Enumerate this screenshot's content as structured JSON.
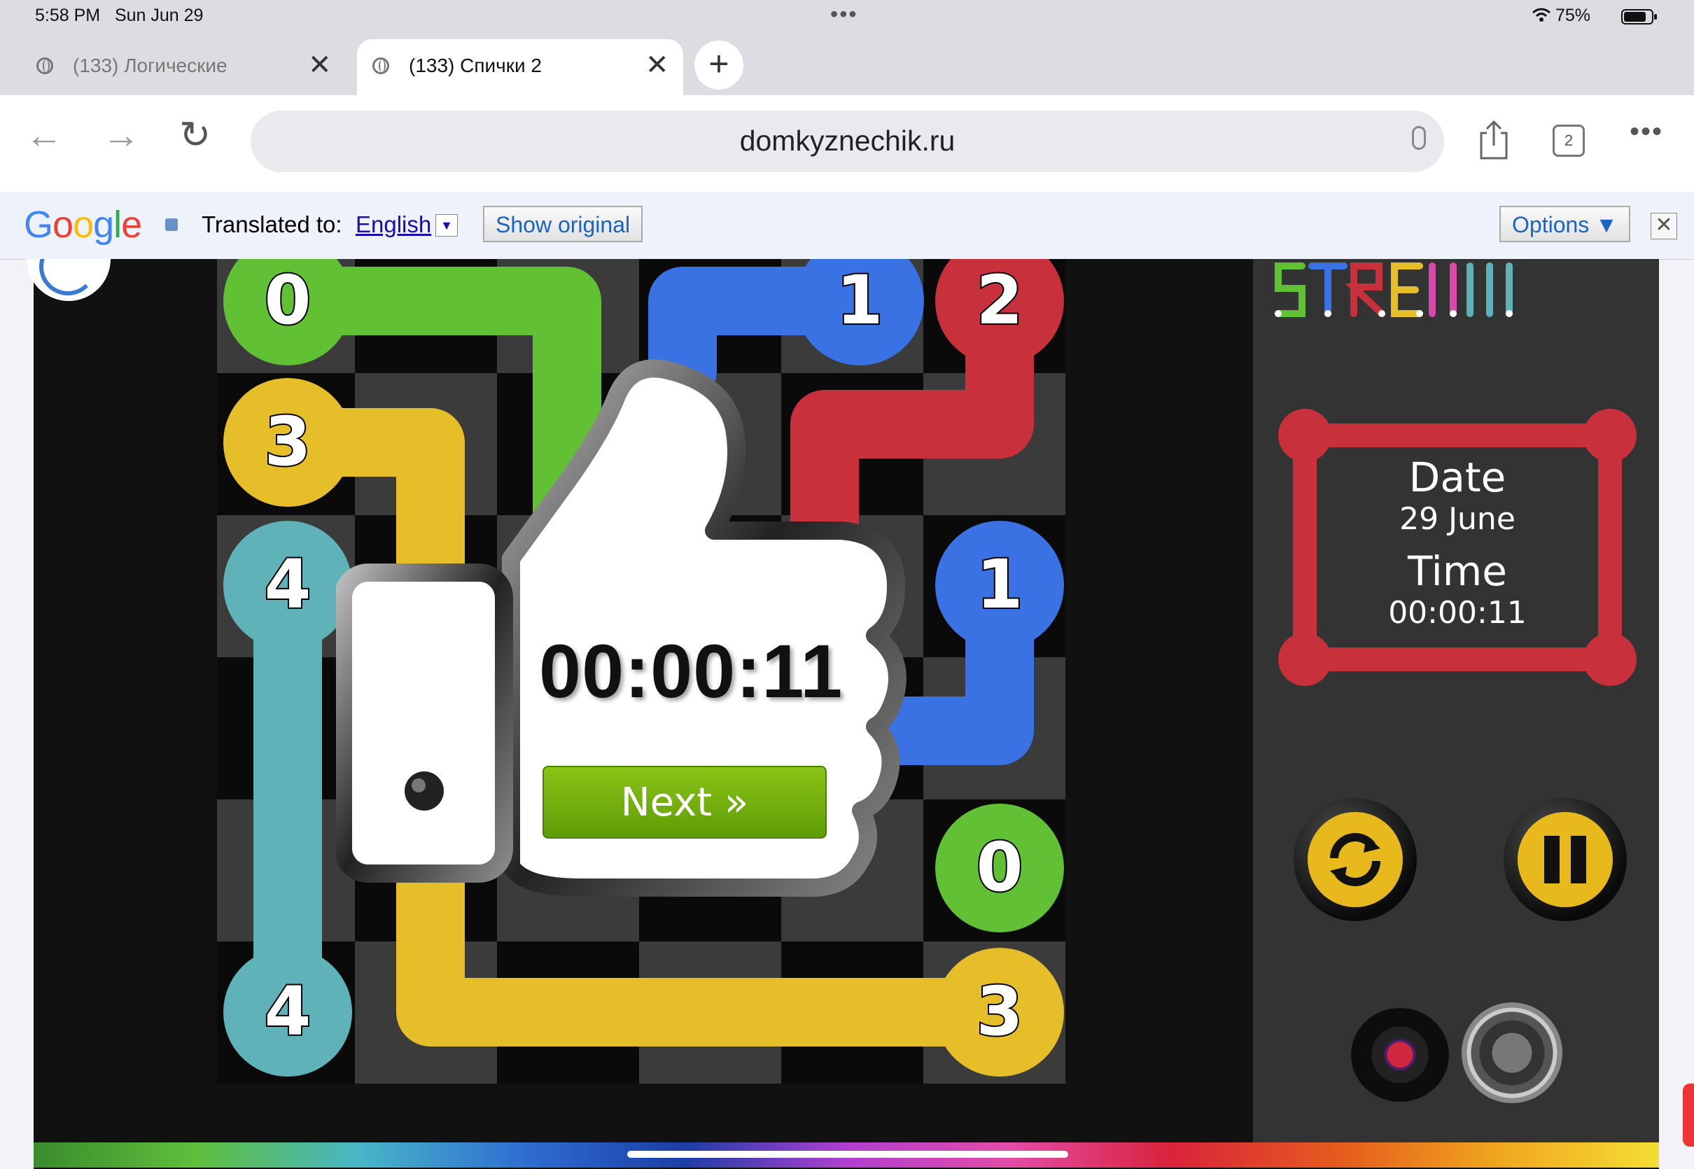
{
  "status": {
    "time": "5:58 PM",
    "date": "Sun Jun 29",
    "battery": "75%"
  },
  "tabs": [
    {
      "label": "(133) Логические",
      "active": false
    },
    {
      "label": "(133) Спички 2",
      "active": true
    }
  ],
  "address": {
    "url": "domkyznechik.ru",
    "tab_count": "2"
  },
  "translate": {
    "logo": "Google",
    "translated_to": "Translated to:",
    "language": "English",
    "show_original": "Show original",
    "options": "Options ▼"
  },
  "board": {
    "cells": [
      [
        "0",
        "",
        "",
        "",
        "1",
        "2"
      ],
      [
        "3",
        "",
        "",
        "",
        "",
        ""
      ],
      [
        "4",
        "",
        "",
        "",
        "",
        "1"
      ],
      [
        "",
        "",
        "",
        "",
        "",
        ""
      ],
      [
        "",
        "",
        "",
        "",
        "",
        "0"
      ],
      [
        "4",
        "",
        "",
        "",
        "",
        "3"
      ]
    ],
    "colors": {
      "green": "#62c034",
      "blue": "#3a72e4",
      "red": "#c8303c",
      "yellow": "#e6be2a",
      "teal": "#5fb3b8"
    }
  },
  "overlay": {
    "time": "00:00:11",
    "next_label": "Next »"
  },
  "sidebar": {
    "logo_text": "STREAM",
    "date_label": "Date",
    "date_value": "29 June",
    "time_label": "Time",
    "time_value": "00:00:11",
    "frame_color": "#c8303c"
  }
}
